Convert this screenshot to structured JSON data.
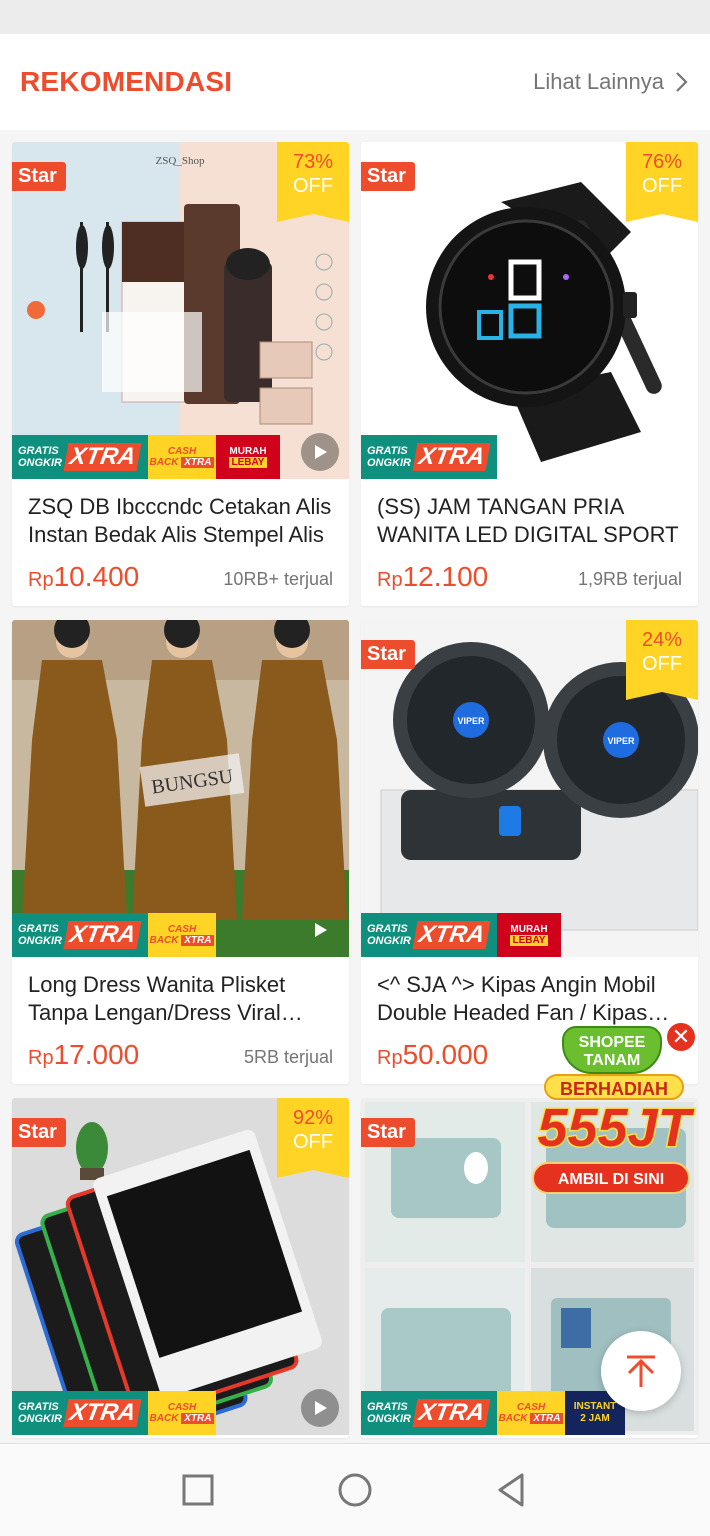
{
  "section": {
    "title": "REKOMENDASI",
    "more_label": "Lihat Lainnya"
  },
  "products": [
    {
      "name": "ZSQ DB Ibcccndc Cetakan Alis Instan Bedak Alis Stempel Alis",
      "currency": "Rp",
      "price": "10.400",
      "sold": "10RB+ terjual",
      "star": "Star",
      "discount": "73%",
      "discount_off": "OFF",
      "badges": [
        "gratis-ongkir-xtra",
        "cashback-xtra",
        "murah-lebay"
      ],
      "has_video": true,
      "image_text": "ZSQ_Shop"
    },
    {
      "name": "(SS) JAM TANGAN PRIA WANITA LED DIGITAL SPORT",
      "currency": "Rp",
      "price": "12.100",
      "sold": "1,9RB terjual",
      "star": "Star",
      "discount": "76%",
      "discount_off": "OFF",
      "badges": [
        "gratis-ongkir-xtra"
      ],
      "has_video": false
    },
    {
      "name": "Long Dress Wanita Plisket Tanpa Lengan/Dress Viral Kekinian",
      "currency": "Rp",
      "price": "17.000",
      "sold": "5RB terjual",
      "star": "",
      "discount": "",
      "discount_off": "",
      "badges": [
        "gratis-ongkir-xtra",
        "cashback-xtra"
      ],
      "has_video": true,
      "image_text": "BUNGSU"
    },
    {
      "name": "<^ SJA ^> Kipas Angin Mobil Double Headed Fan / Kipas Angin",
      "currency": "Rp",
      "price": "50.000",
      "sold": "",
      "star": "Star",
      "discount": "24%",
      "discount_off": "OFF",
      "badges": [
        "gratis-ongkir-xtra",
        "murah-lebay"
      ],
      "has_video": false,
      "image_text": "VIPER"
    },
    {
      "name": "",
      "currency": "",
      "price": "",
      "sold": "",
      "star": "Star",
      "discount": "92%",
      "discount_off": "OFF",
      "badges": [
        "gratis-ongkir-xtra",
        "cashback-xtra"
      ],
      "has_video": true
    },
    {
      "name": "",
      "currency": "",
      "price": "",
      "sold": "",
      "star": "Star",
      "discount": "",
      "discount_off": "",
      "badges": [
        "gratis-ongkir-xtra",
        "cashback-xtra",
        "instant-2-jam"
      ],
      "has_video": false
    }
  ],
  "badge_labels": {
    "gratis_line1": "GRATIS",
    "gratis_line2": "ONGKIR",
    "xtra": "XTRA",
    "cashback_line1": "CASH",
    "cashback_line2": "BACK",
    "cashback_xtra": "XTRA",
    "murah_line1": "MURAH",
    "murah_line2": "LEBAY",
    "instant_line1": "INSTANT",
    "instant_line2": "2 JAM"
  },
  "floating": {
    "tanam_logo": "SHOPEE TANAM",
    "tanam_title": "BERHADIAH",
    "tanam_amount": "555JT",
    "tanam_cta": "AMBIL DI SINI",
    "close_symbol": "✕"
  },
  "colors": {
    "brand": "#ee4d2d",
    "discount_bg": "#ffd424",
    "gratis_bg": "#0f8f7e",
    "text": "#222222",
    "muted": "#757575"
  },
  "nav": {
    "recent": "square-icon",
    "home": "circle-icon",
    "back": "triangle-back-icon"
  }
}
